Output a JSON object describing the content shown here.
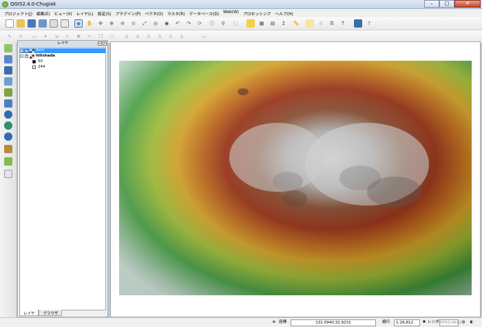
{
  "window": {
    "title": "QGIS2.4.0-Chugiak"
  },
  "menu": [
    "プロジェクト(J)",
    "編集(E)",
    "ビュー(V)",
    "レイヤ(L)",
    "設定(S)",
    "プラグイン(P)",
    "ベクタ(O)",
    "ラスタ(R)",
    "データベース(D)",
    "Web(W)",
    "プロセッシング",
    "ヘルプ(H)"
  ],
  "layers_panel": {
    "title": "レイヤ",
    "layers": [
      {
        "name": "dem",
        "checked": true,
        "selected": true
      },
      {
        "name": "hillshade",
        "checked": true,
        "selected": false
      }
    ],
    "legend": [
      {
        "value": "50",
        "color": "#000000"
      },
      {
        "value": "244",
        "color": "#ffffff"
      }
    ],
    "tabs": [
      "レイヤ",
      "ブラウザ"
    ]
  },
  "status": {
    "coord_label": "座標",
    "coordinates": "131.0940,32.9231",
    "scale_label": "縮尺",
    "scale": "1:29,612",
    "render_label": "レンダ",
    "crs": "EPSG:4612"
  }
}
